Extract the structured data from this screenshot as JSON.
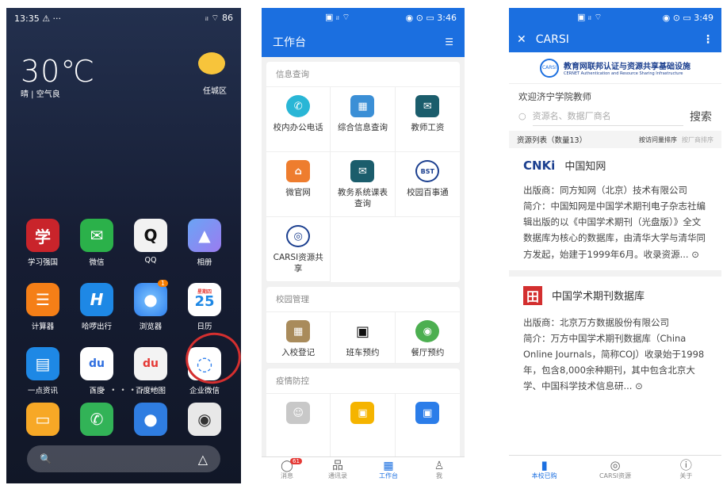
{
  "phone1": {
    "status": {
      "time": "13:35",
      "left_icons": "⚠ ···",
      "right_icons": "ᵢₗ ⌔ 86"
    },
    "weather": {
      "temp": "30℃",
      "desc": "晴 | 空气良",
      "city": "任城区"
    },
    "rows": [
      [
        {
          "label": "学习强国",
          "icon": "学",
          "color": "#c9242b"
        },
        {
          "label": "微信",
          "icon": "✉",
          "color": "#2bb14a"
        },
        {
          "label": "QQ",
          "icon": "Q",
          "color": "#f2f2f2"
        },
        {
          "label": "相册",
          "icon": "▲",
          "color": "#4e86f0"
        }
      ],
      [
        {
          "label": "计算器",
          "icon": "☰",
          "color": "#f57f17"
        },
        {
          "label": "哈啰出行",
          "icon": "H",
          "color": "#1e88e5"
        },
        {
          "label": "浏览器",
          "icon": "●",
          "color": "#2f80ed"
        },
        {
          "label": "日历",
          "icon": "25",
          "color": "#ffffff"
        }
      ],
      [
        {
          "label": "一点资讯",
          "icon": "▤",
          "color": "#1e88e5"
        },
        {
          "label": "百度",
          "icon": "du",
          "color": "#ffffff"
        },
        {
          "label": "百度地图",
          "icon": "du",
          "color": "#f3f3f3"
        },
        {
          "label": "企业微信",
          "icon": "◌",
          "color": "#ffffff"
        }
      ]
    ],
    "calendar_day": "星期四",
    "browser_badge": "1",
    "dock": [
      {
        "name": "notes",
        "icon": "▭",
        "color": "#f7a826"
      },
      {
        "name": "phone",
        "icon": "✆",
        "color": "#32b357"
      },
      {
        "name": "contacts",
        "icon": "●",
        "color": "#2f7de1"
      },
      {
        "name": "camera",
        "icon": "◉",
        "color": "#e8e8e8"
      }
    ],
    "page_dots": "• • • • • • •",
    "search_left": "🔍",
    "search_right": "△"
  },
  "phone2": {
    "status": {
      "left": "▣ ᵢₗ ⌔",
      "right": "◉ ⊙ ▭ 3:46"
    },
    "title": "工作台",
    "menu_icon": "☰",
    "sections": [
      {
        "title": "信息查询",
        "items": [
          {
            "label": "校内办公电话",
            "icon": "✆",
            "color": "#29b6d6"
          },
          {
            "label": "综合信息查询",
            "icon": "▦",
            "color": "#3b8fd6"
          },
          {
            "label": "教师工资",
            "icon": "✉",
            "color": "#1b5d6c"
          },
          {
            "label": "微官网",
            "icon": "⌂",
            "color": "#ee7d2e"
          },
          {
            "label": "教务系统课表查询",
            "icon": "✉",
            "color": "#1b5d6c"
          },
          {
            "label": "校园百事通",
            "icon": "BST",
            "color": "#ffffff"
          },
          {
            "label": "CARSI资源共享",
            "icon": "◎",
            "color": "#ffffff"
          }
        ]
      },
      {
        "title": "校园管理",
        "items": [
          {
            "label": "入校登记",
            "icon": "▦",
            "color": "#a98b5b"
          },
          {
            "label": "班车预约",
            "icon": "▣",
            "color": "#ffffff"
          },
          {
            "label": "餐厅预约",
            "icon": "◉",
            "color": "#4caf50"
          }
        ]
      },
      {
        "title": "疫情防控",
        "items": [
          {
            "label": "",
            "icon": "☺",
            "color": "#c8c8c8"
          },
          {
            "label": "",
            "icon": "▣",
            "color": "#f5b400"
          },
          {
            "label": "",
            "icon": "▣",
            "color": "#2b7de9"
          }
        ]
      }
    ],
    "tabs": [
      {
        "label": "消息",
        "icon": "◯",
        "badge": "61"
      },
      {
        "label": "通讯录",
        "icon": "品"
      },
      {
        "label": "工作台",
        "icon": "▦"
      },
      {
        "label": "我",
        "icon": "♙"
      }
    ]
  },
  "phone3": {
    "status": {
      "left": "▣ ᵢₗ ⌔",
      "right": "◉ ⊙ ▭ 3:49"
    },
    "close": "✕",
    "title": "CARSI",
    "more": "⋮",
    "logo": {
      "mark": "CARSI",
      "text": "教育网联邦认证与资源共享基础设施",
      "sub": "CERNET Authentication and Resource Sharing Infrastructure"
    },
    "welcome": "欢迎济宁学院教师",
    "search": {
      "placeholder": "资源名、数据厂商名",
      "button": "搜索"
    },
    "list": {
      "label": "资源列表（数量13）",
      "sort1": "按访问量排序",
      "sort2": "按厂商排序"
    },
    "results": [
      {
        "logo": "CNKi",
        "name": "中国知网",
        "publisher": "出版商：同方知网（北京）技术有限公司",
        "intro": "简介：中国知网是中国学术期刊电子杂志社编辑出版的以《中国学术期刊（光盘版）》全文数据库为核心的数据库，由清华大学与清华同方发起，始建于1999年6月。收录资源... ⊙"
      },
      {
        "logo": "田",
        "name": "中国学术期刊数据库",
        "publisher": "出版商：北京万方数据股份有限公司",
        "intro": "简介：万方中国学术期刊数据库（China Online Journals，简称COJ）收录始于1998年，包含8,000余种期刊，其中包含北京大学、中国科学技术信息研... ⊙"
      }
    ],
    "tabs": [
      {
        "label": "本校已购",
        "icon": "▮"
      },
      {
        "label": "CARSI资源",
        "icon": "◎"
      },
      {
        "label": "关于",
        "icon": "ⓘ"
      }
    ]
  }
}
